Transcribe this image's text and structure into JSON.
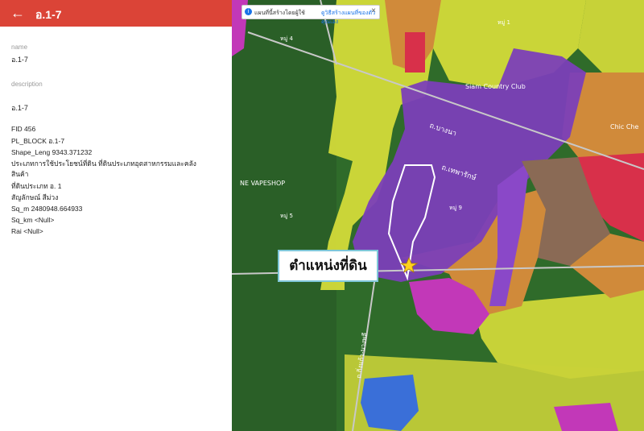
{
  "header": {
    "title": "อ.1-7",
    "back_label": "←"
  },
  "fields": {
    "name_label": "name",
    "name_value": "อ.1-7",
    "description_label": "description",
    "description_value": "อ.1-7"
  },
  "attributes": [
    "FID 456",
    "PL_BLOCK อ.1-7",
    "Shape_Leng 9343.371232",
    "ประเภทการใช้ประโยชน์ที่ดิน ที่ดินประเภทอุตสาหกรรมและคลัง",
    "สินค้า",
    "ที่ดินประเภท อ. 1",
    "สัญลักษณ์ สีม่วง",
    "Sq_m 2480948.664933",
    "Sq_km <Null>",
    "Rai <Null>"
  ],
  "map": {
    "notice_text": "แผนที่นี้สร้างโดยผู้ใช้",
    "notice_link": "ดูวิธีสร้างแผนที่ของตัวคุณเอง",
    "notice_close": "×",
    "callout_text": "ตำแหน่งที่ดิน",
    "road_label_1": "ถ.บางนา",
    "road_label_2": "ถ.เทพารักษ์",
    "road_label_3": "ถ.กิ่งแก้ว-บางพลี",
    "place_labels": [
      "Siam Country Club",
      "Chic Che",
      "NE VAPESHOP",
      "หมู่ 4",
      "หมู่ 5",
      "หมู่ 9",
      "หมู่ 1"
    ]
  },
  "colors": {
    "header_red": "#db4437",
    "zone_purple": "#7b3fb8",
    "zone_yellow": "#d8de3a",
    "zone_orange": "#d08a3a",
    "zone_magenta": "#c238b8",
    "zone_red": "#d8304a",
    "zone_blue": "#3a6fd8",
    "zone_brown": "#8a6a55",
    "base_green": "#2f6b2a"
  }
}
